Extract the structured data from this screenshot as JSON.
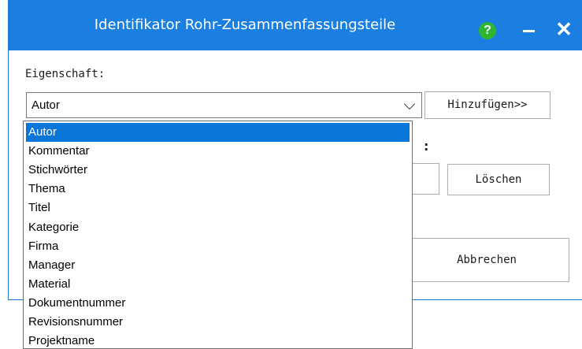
{
  "window": {
    "title": "Identifikator Rohr-Zusammenfassungsteile",
    "help_glyph": "?",
    "close_glyph": "✕"
  },
  "form": {
    "property_label": "Eigenschaft:",
    "property_value": "Autor",
    "add_button": "Hinzufügen>>",
    "delete_button": "Löschen",
    "cancel_button": "Abbrechen",
    "hidden_label_suffix": ":"
  },
  "dropdown": {
    "items": [
      "Autor",
      "Kommentar",
      "Stichwörter",
      "Thema",
      "Titel",
      "Kategorie",
      "Firma",
      "Manager",
      "Material",
      "Dokumentnummer",
      "Revisionsnummer",
      "Projektname"
    ],
    "selected": "Autor"
  },
  "colors": {
    "titlebar": "#1a7fe0",
    "selection": "#0a77d8",
    "help": "#2fb532"
  }
}
